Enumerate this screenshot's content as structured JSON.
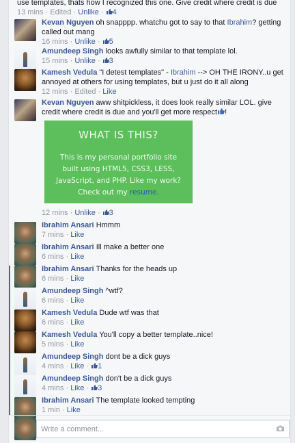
{
  "comments": [
    {
      "text": "use templates, thats how I recognized this one. Give credit where credit is due",
      "time": "13 mins",
      "edited": "Edited",
      "unlike": "Unlike",
      "likes": "4"
    },
    {
      "author": "Kevan Nguyen",
      "text_a": "oh snapppp. whatchu got to say to that ",
      "mention": "Ibrahim",
      "text_b": "? getting called out mang",
      "time": "16 mins",
      "unlike": "Unlike",
      "likes": "5"
    },
    {
      "author": "Amundeep Singh",
      "text": "looks awfully similar to that template lol.",
      "time": "15 mins",
      "unlike": "Unlike",
      "likes": "3"
    },
    {
      "author": "Kamesh Vedula",
      "text_a": "\"I detest templates\" - ",
      "mention": "Ibrahim",
      "text_b": " --> OH THE IRONY..u get annoyed at others for using templates, but u just do it all along",
      "time": "12 mins",
      "edited": "Edited",
      "like": "Like"
    },
    {
      "author": "Kevan Nguyen",
      "text": "aww shitpickless, it does look really similar LOL. give credit where credit is due and you'll get more respect",
      "time": "12 mins",
      "unlike": "Unlike",
      "likes": "3"
    },
    {
      "author": "Ibrahim Ansari",
      "text": "Hmmm",
      "time": "7 mins",
      "like": "Like"
    },
    {
      "author": "Ibrahim Ansari",
      "text": "Ill make a better one",
      "time": "6 mins",
      "like": "Like"
    },
    {
      "author": "Ibrahim Ansari",
      "text": "Thanks for the heads up",
      "time": "6 mins",
      "like": "Like"
    },
    {
      "author": "Amundeep Singh",
      "text": "^wtf?",
      "time": "6 mins",
      "like": "Like"
    },
    {
      "author": "Kamesh Vedula",
      "text": "Dude wtf was that",
      "time": "6 mins",
      "like": "Like"
    },
    {
      "author": "Kamesh Vedula",
      "text": "You'll copy a better template..nice!",
      "time": "5 mins",
      "like": "Like"
    },
    {
      "author": "Amundeep Singh",
      "text": "dont be a dick guys",
      "time": "4 mins",
      "like": "Like",
      "likes": "1"
    },
    {
      "author": "Amundeep Singh",
      "text": "don't be a dick guys",
      "time": "4 mins",
      "like": "Like",
      "likes": "3"
    },
    {
      "author": "Ibrahim Ansari",
      "text": "The template looked tempting",
      "time": "1 min",
      "like": "Like"
    }
  ],
  "preview": {
    "title": "WHAT IS THIS?",
    "body": "This is my personal portfolio site built using HTML5, CSS3, LESS, JavaScript, and PHP. Like my work? Check out my",
    "link": "resume.",
    "bg_color": "#5cbf5b"
  },
  "composer": {
    "placeholder": "Write a comment...",
    "icon": "camera-icon"
  },
  "separator": " · ",
  "colors": {
    "link": "#3b5998",
    "meta": "#9197a3",
    "marker": "#4267b2"
  }
}
